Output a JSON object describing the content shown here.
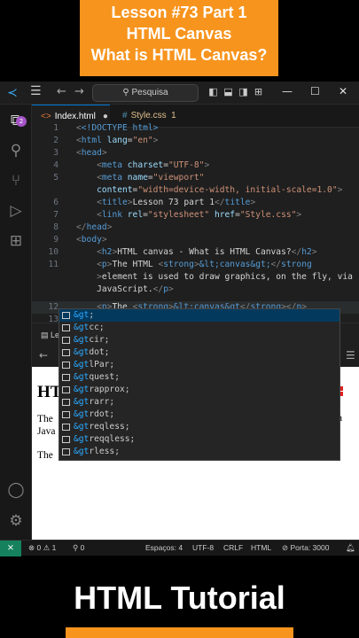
{
  "banner": {
    "line1": "Lesson #73 Part 1",
    "line2": "HTML Canvas",
    "line3": "What is HTML Canvas?"
  },
  "titlebar": {
    "search_label": "Pesquisa",
    "search_icon": "magnifier-icon"
  },
  "badge_count": "2",
  "tabs": [
    {
      "label": "Index.html",
      "modified": "●"
    },
    {
      "label": "Style.css",
      "count": "1"
    }
  ],
  "editor": {
    "line_numbers": [
      "1",
      "2",
      "3",
      "4",
      "5",
      "6",
      "7",
      "8",
      "9",
      "10",
      "11",
      "",
      "12",
      "13"
    ],
    "lines": {
      "l1": "<!DOCTYPE html>",
      "l2_tag": "html",
      "l2_attr": "lang",
      "l2_val": "\"en\"",
      "l3": "head",
      "l4_attr": "charset",
      "l4_val": "\"UTF-8\"",
      "l5_attr": "name",
      "l5_val": "\"viewport\"",
      "l5b_attr": "content",
      "l5b_val": "\"width=device-width, initial-scale=1.0\"",
      "l6_text": "Lesson 73 part 1",
      "l7_attr1": "rel",
      "l7_val1": "\"stylesheet\"",
      "l7_attr2": "href",
      "l7_val2": "\"Style.css\"",
      "l8": "head",
      "l9": "body",
      "l10_text": "HTML canvas - What is HTML Canvas?",
      "l11_text1": "The HTML ",
      "l11_ent": "&lt;canvas&gt;",
      "l11b_text": "element is used to draw graphics, on the fly, via",
      "l11c_text": "JavaScript.",
      "l12_text": "The ",
      "l12_ent": "&lt;canvas&gt"
    }
  },
  "suggestions": [
    "&gt;",
    "&gtcc;",
    "&gtcir;",
    "&gtdot;",
    "&gtlPar;",
    "&gtquest;",
    "&gtrapprox;",
    "&gtrarr;",
    "&gtrdot;",
    "&gtreqless;",
    "&gtreqqless;",
    "&gtrless;"
  ],
  "panel": {
    "tab_label": "Le"
  },
  "preview": {
    "h2": "HT",
    "p1": "The",
    "p1b": "Java",
    "p2": "The",
    "right": "via"
  },
  "statusbar": {
    "errors": "0",
    "warnings": "1",
    "ports": "0",
    "spaces": "Espaços: 4",
    "encoding": "UTF-8",
    "eol": "CRLF",
    "lang": "HTML",
    "port": "Porta: 3000"
  },
  "footer": {
    "title": "HTML Tutorial"
  },
  "colors": {
    "accent": "#f7941d",
    "editor_bg": "#1f1f1f",
    "remote": "#16825d"
  }
}
